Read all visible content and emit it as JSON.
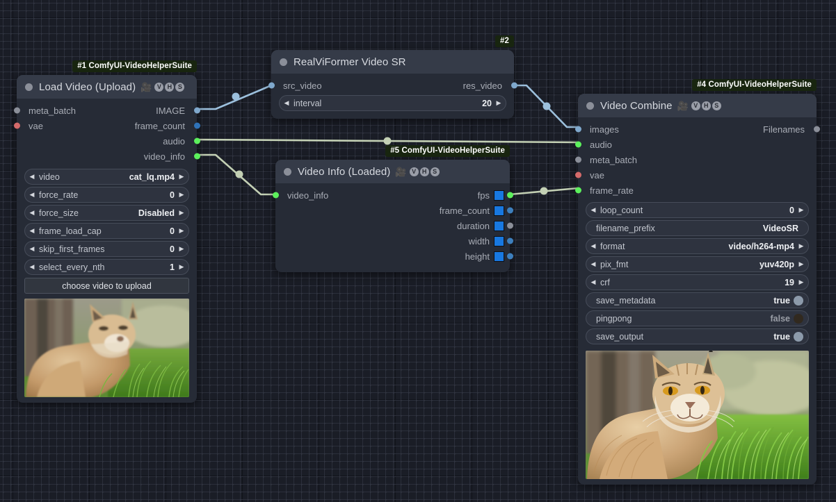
{
  "canvas": {
    "bg": "#1a1d26",
    "grid_minor": "11",
    "grid_major": "110"
  },
  "colors": {
    "node_body": "#262b36",
    "node_title": "#353b48",
    "badge_bg": "#18250f",
    "link_image": "#9cc0dd",
    "link_green": "#c3d0b4",
    "dot_image": "#7fa8cc",
    "dot_int": "#2f72b8",
    "dot_green": "#5cf05c",
    "dot_grey": "#8b8f99",
    "dot_vae": "#d46a6a",
    "swatch_blue": "#1878e0"
  },
  "nodes": [
    {
      "id": "node-load",
      "badge": "#1 ComfyUI-VideoHelperSuite",
      "title": "Load Video (Upload)",
      "icons": [
        "movie-camera-icon",
        "V",
        "H",
        "S"
      ],
      "inputs": [
        {
          "label": "meta_batch",
          "color": "#8b8f99"
        },
        {
          "label": "vae",
          "color": "#d46a6a"
        }
      ],
      "outputs": [
        {
          "label": "IMAGE",
          "color": "#7fa8cc"
        },
        {
          "label": "frame_count",
          "color": "#2f72b8"
        },
        {
          "label": "audio",
          "color": "#5cf05c"
        },
        {
          "label": "video_info",
          "color": "#5cf05c"
        }
      ],
      "widgets": [
        {
          "type": "combo",
          "label": "video",
          "value": "cat_lq.mp4"
        },
        {
          "type": "number",
          "label": "force_rate",
          "value": "0"
        },
        {
          "type": "combo",
          "label": "force_size",
          "value": "Disabled"
        },
        {
          "type": "number",
          "label": "frame_load_cap",
          "value": "0"
        },
        {
          "type": "number",
          "label": "skip_first_frames",
          "value": "0"
        },
        {
          "type": "number",
          "label": "select_every_nth",
          "value": "1"
        }
      ],
      "button": "choose video to upload",
      "preview": "lynx-low-quality-thumbnail"
    },
    {
      "id": "node-sr",
      "badge": "#2",
      "title": "RealViFormer Video SR",
      "icons": [],
      "inputs": [
        {
          "label": "src_video",
          "color": "#7fa8cc"
        }
      ],
      "outputs": [
        {
          "label": "res_video",
          "color": "#7fa8cc"
        }
      ],
      "widgets": [
        {
          "type": "number",
          "label": "interval",
          "value": "20"
        }
      ],
      "button": null,
      "preview": null
    },
    {
      "id": "node-info",
      "badge": "#5 ComfyUI-VideoHelperSuite",
      "title": "Video Info (Loaded)",
      "icons": [
        "movie-camera-icon",
        "V",
        "H",
        "S"
      ],
      "inputs": [
        {
          "label": "video_info",
          "color": "#5cf05c"
        }
      ],
      "outputs": [
        {
          "label": "fps",
          "color": "#5cf05c",
          "swatch": true
        },
        {
          "label": "frame_count",
          "color": "#3d7fbd",
          "swatch": true
        },
        {
          "label": "duration",
          "color": "#8b8f99",
          "swatch": true
        },
        {
          "label": "width",
          "color": "#3d7fbd",
          "swatch": true
        },
        {
          "label": "height",
          "color": "#3d7fbd",
          "swatch": true
        }
      ],
      "widgets": [],
      "button": null,
      "preview": null
    },
    {
      "id": "node-combine",
      "badge": "#4 ComfyUI-VideoHelperSuite",
      "title": "Video Combine",
      "icons": [
        "movie-camera-icon",
        "V",
        "H",
        "S"
      ],
      "inputs": [
        {
          "label": "images",
          "color": "#7fa8cc"
        },
        {
          "label": "audio",
          "color": "#5cf05c"
        },
        {
          "label": "meta_batch",
          "color": "#8b8f99"
        },
        {
          "label": "vae",
          "color": "#d46a6a"
        },
        {
          "label": "frame_rate",
          "color": "#5cf05c"
        }
      ],
      "outputs": [
        {
          "label": "Filenames",
          "color": "#8b8f99"
        }
      ],
      "widgets": [
        {
          "type": "number",
          "label": "loop_count",
          "value": "0"
        },
        {
          "type": "text",
          "label": "filename_prefix",
          "value": "VideoSR"
        },
        {
          "type": "combo",
          "label": "format",
          "value": "video/h264-mp4"
        },
        {
          "type": "combo",
          "label": "pix_fmt",
          "value": "yuv420p"
        },
        {
          "type": "number",
          "label": "crf",
          "value": "19"
        },
        {
          "type": "toggle",
          "label": "save_metadata",
          "value": "true"
        },
        {
          "type": "toggle",
          "label": "pingpong",
          "value": "false"
        },
        {
          "type": "toggle",
          "label": "save_output",
          "value": "true"
        }
      ],
      "button": null,
      "preview": "lynx-upscaled-thumbnail"
    }
  ],
  "links": [
    {
      "from": "node-load.IMAGE",
      "to": "node-sr.src_video",
      "color": "#9cc0dd"
    },
    {
      "from": "node-sr.res_video",
      "to": "node-combine.images",
      "color": "#9cc0dd"
    },
    {
      "from": "node-load.audio",
      "to": "node-combine.audio",
      "color": "#c3d0b4"
    },
    {
      "from": "node-load.video_info",
      "to": "node-info.video_info",
      "color": "#c3d0b4"
    },
    {
      "from": "node-info.fps",
      "to": "node-combine.frame_rate",
      "color": "#c3d0b4"
    }
  ]
}
